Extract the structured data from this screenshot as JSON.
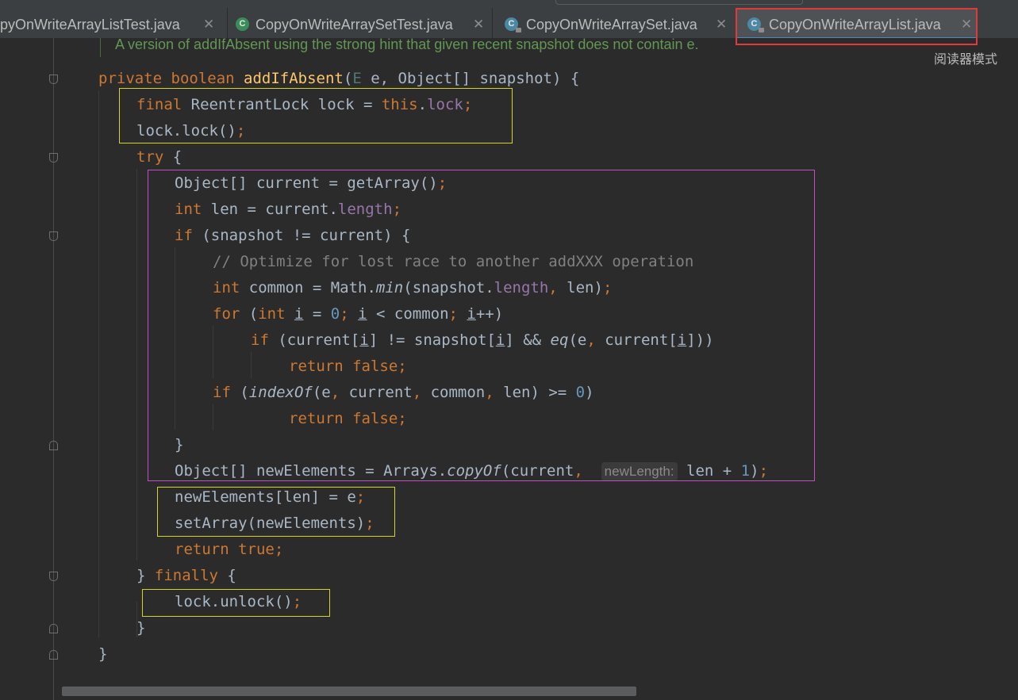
{
  "tabs": [
    {
      "label": "pyOnWriteArrayListTest.java",
      "icon": "java-class-icon",
      "active": false
    },
    {
      "label": "CopyOnWriteArraySetTest.java",
      "icon": "java-test-class-icon",
      "active": false
    },
    {
      "label": "CopyOnWriteArraySet.java",
      "icon": "java-class-readonly-icon",
      "active": false
    },
    {
      "label": "CopyOnWriteArrayList.java",
      "icon": "java-class-readonly-icon",
      "active": true
    }
  ],
  "close_glyph": "✕",
  "reader_mode_label": "阅读器模式",
  "code": {
    "doc_line": "A version of addIfAbsent using the strong hint that given recent snapshot does not contain e.",
    "comment": "// Optimize for lost race to another addXXX operation",
    "param_hint": "newLength:"
  },
  "colors": {
    "background": "#2b2b2b",
    "keyword": "#cc7832",
    "method": "#ffc66d",
    "field": "#9876aa",
    "number": "#6897bb",
    "comment": "#808080",
    "doc": "#629755",
    "highlight_red": "#e03a3a",
    "highlight_yellow": "#d4d420",
    "highlight_magenta": "#c04ec8"
  }
}
